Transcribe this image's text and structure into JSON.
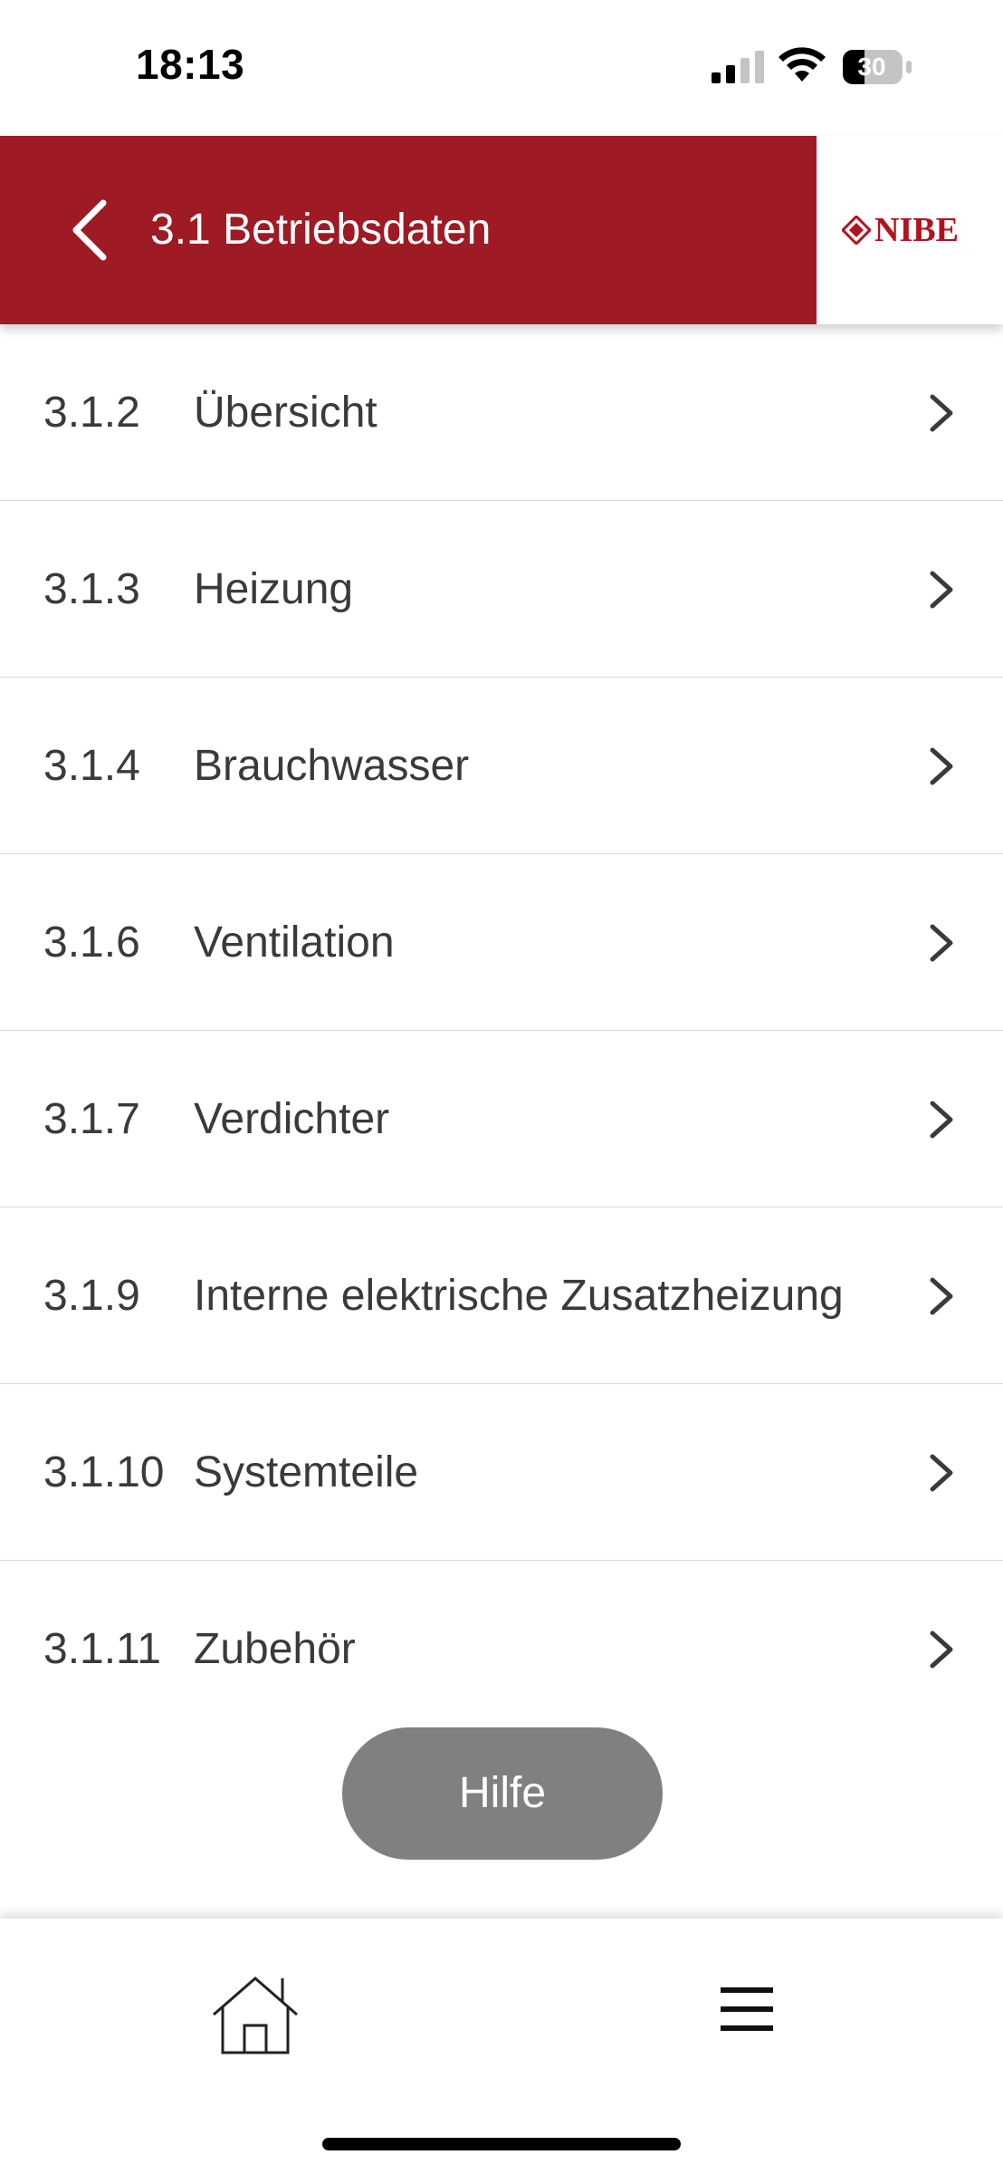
{
  "status_bar": {
    "time": "18:13",
    "battery_level": "30",
    "icons": [
      "signal-icon",
      "wifi-icon",
      "battery-icon"
    ]
  },
  "header": {
    "title": "3.1 Betriebsdaten",
    "back_icon": "chevron-left-icon",
    "logo_text": "NIBE",
    "background_color": "#9e1a24"
  },
  "menu": {
    "items": [
      {
        "number": "3.1.2",
        "label": "Übersicht"
      },
      {
        "number": "3.1.3",
        "label": "Heizung"
      },
      {
        "number": "3.1.4",
        "label": "Brauchwasser"
      },
      {
        "number": "3.1.6",
        "label": "Ventilation"
      },
      {
        "number": "3.1.7",
        "label": "Verdichter"
      },
      {
        "number": "3.1.9",
        "label": "Interne elektrische Zusatzheizung"
      },
      {
        "number": "3.1.10",
        "label": "Systemteile"
      },
      {
        "number": "3.1.11",
        "label": "Zubehör"
      }
    ],
    "item_icon": "chevron-right-icon"
  },
  "help_button": {
    "label": "Hilfe",
    "color": "#808080"
  },
  "bottom_nav": {
    "items": [
      {
        "name": "home",
        "icon": "home-icon"
      },
      {
        "name": "menu",
        "icon": "hamburger-menu-icon"
      }
    ]
  }
}
